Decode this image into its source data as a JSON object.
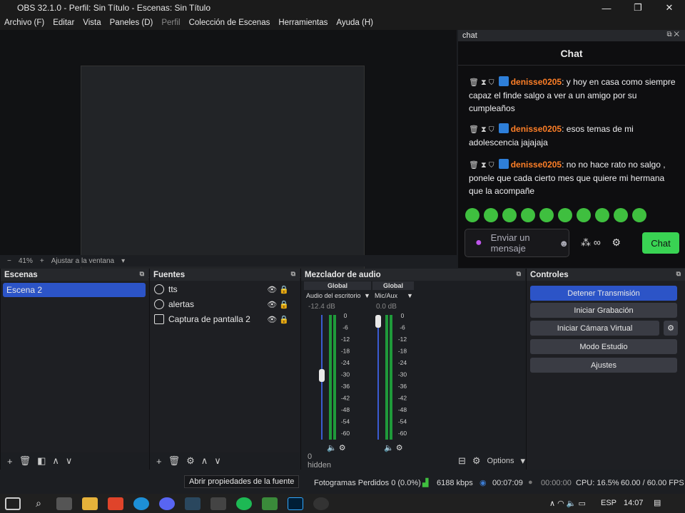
{
  "window": {
    "title": "OBS 32.1.0 - Perfil: Sin Título - Escenas: Sin Título"
  },
  "menu": [
    "Archivo (F)",
    "Editar",
    "Vista",
    "Paneles (D)",
    "Perfil",
    "Colección de Escenas",
    "Herramientas",
    "Ayuda (H)"
  ],
  "preview": {
    "zoom": "41%",
    "fit": "Ajustar a la ventana"
  },
  "chat": {
    "dock_title": "chat",
    "title": "Chat",
    "messages": [
      {
        "user": "denisse0205",
        "text": ": y hoy en casa como siempre capaz el finde salgo a ver a un amigo por su cumpleaños"
      },
      {
        "user": "denisse0205",
        "text": ": esos temas de mi adolescencia jajajaja"
      },
      {
        "user": "denisse0205",
        "text": ": no no hace rato no salgo , ponele que cada cierto mes que quiere mi hermana que la acompañe"
      }
    ],
    "input_placeholder": "Enviar un mensaje",
    "send_label": "Chat"
  },
  "scenes": {
    "title": "Escenas",
    "items": [
      "Escena 2"
    ]
  },
  "sources": {
    "title": "Fuentes",
    "items": [
      "tts",
      "alertas",
      "Captura de pantalla 2"
    ]
  },
  "mixer": {
    "title": "Mezclador de audio",
    "channels": [
      {
        "global": "Global",
        "name": "Audio del escritorio",
        "db": "-12.4 dB",
        "level": 0.5
      },
      {
        "global": "Global",
        "name": "Mic/Aux",
        "db": "0.0 dB",
        "level": 0.98
      }
    ],
    "ticks": [
      "0",
      "-6",
      "-12",
      "-18",
      "-24",
      "-30",
      "-36",
      "-42",
      "-48",
      "-54",
      "-60"
    ],
    "hidden": "0 hidden",
    "options": "Options"
  },
  "controls": {
    "title": "Controles",
    "buttons": [
      "Detener Transmisión",
      "Iniciar Grabación",
      "Iniciar Cámara Virtual",
      "Modo Estudio",
      "Ajustes"
    ]
  },
  "status": {
    "dropped": "Fotogramas Perdidos 0 (0.0%)",
    "kbps": "6188 kbps",
    "stream_time": "00:07:09",
    "rec_time": "00:00:00",
    "cpu": "CPU: 16.5%",
    "fps": "60.00 / 60.00 FPS"
  },
  "tooltip": "Abrir propiedades de la fuente",
  "taskbar": {
    "lang": "ESP",
    "time": "14:07"
  }
}
